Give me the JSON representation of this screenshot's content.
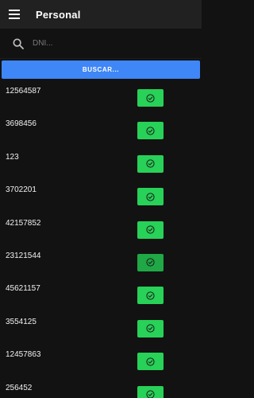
{
  "appbar": {
    "title": "Personal",
    "menu_icon": "menu-icon"
  },
  "search": {
    "placeholder": "DNI...",
    "value": ""
  },
  "buscar": {
    "label": "BUSCAR..."
  },
  "colors": {
    "accent": "#3f86f7",
    "check": "#28d157",
    "check_pressed": "#1fa845",
    "appbar": "#212121",
    "background": "#121212"
  },
  "rows": [
    {
      "id": "12564587",
      "action_icon": "check-circle-icon"
    },
    {
      "id": "3698456",
      "action_icon": "check-circle-icon"
    },
    {
      "id": "123",
      "action_icon": "check-circle-icon"
    },
    {
      "id": "3702201",
      "action_icon": "check-circle-icon"
    },
    {
      "id": "42157852",
      "action_icon": "check-circle-icon"
    },
    {
      "id": "23121544",
      "action_icon": "check-circle-icon"
    },
    {
      "id": "45621157",
      "action_icon": "check-circle-icon"
    },
    {
      "id": "3554125",
      "action_icon": "check-circle-icon"
    },
    {
      "id": "12457863",
      "action_icon": "check-circle-icon"
    },
    {
      "id": "256452",
      "action_icon": "check-circle-icon"
    }
  ]
}
